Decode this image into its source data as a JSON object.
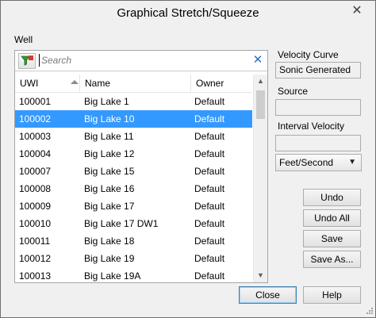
{
  "window": {
    "title": "Graphical Stretch/Squeeze",
    "close_glyph": "✕"
  },
  "well": {
    "label": "Well",
    "search": {
      "placeholder": "Search",
      "value": ""
    },
    "columns": [
      "UWI",
      "Name",
      "Owner"
    ],
    "rows": [
      {
        "uwi": "100001",
        "name": "Big Lake 1",
        "owner": "Default",
        "selected": false
      },
      {
        "uwi": "100002",
        "name": "Big Lake 10",
        "owner": "Default",
        "selected": true
      },
      {
        "uwi": "100003",
        "name": "Big Lake 11",
        "owner": "Default",
        "selected": false
      },
      {
        "uwi": "100004",
        "name": "Big Lake 12",
        "owner": "Default",
        "selected": false
      },
      {
        "uwi": "100007",
        "name": "Big Lake 15",
        "owner": "Default",
        "selected": false
      },
      {
        "uwi": "100008",
        "name": "Big Lake 16",
        "owner": "Default",
        "selected": false
      },
      {
        "uwi": "100009",
        "name": "Big Lake 17",
        "owner": "Default",
        "selected": false
      },
      {
        "uwi": "100010",
        "name": "Big Lake 17 DW1",
        "owner": "Default",
        "selected": false
      },
      {
        "uwi": "100011",
        "name": "Big Lake 18",
        "owner": "Default",
        "selected": false
      },
      {
        "uwi": "100012",
        "name": "Big Lake 19",
        "owner": "Default",
        "selected": false
      },
      {
        "uwi": "100013",
        "name": "Big Lake 19A",
        "owner": "Default",
        "selected": false
      }
    ]
  },
  "velocity_curve": {
    "label": "Velocity Curve",
    "value": "Sonic Generated"
  },
  "source": {
    "label": "Source",
    "value": ""
  },
  "interval_velocity": {
    "label": "Interval Velocity",
    "value": ""
  },
  "units_select": {
    "value": "Feet/Second"
  },
  "buttons": {
    "undo": "Undo",
    "undo_all": "Undo All",
    "save": "Save",
    "save_as": "Save As...",
    "close": "Close",
    "help": "Help"
  },
  "colors": {
    "selection": "#3399ff",
    "clear_icon": "#2a6fc9",
    "filter_icon_green": "#2e9a2e",
    "filter_icon_red": "#d93a2b"
  },
  "icons": {
    "filter": "filter-funnel-icon",
    "clear": "clear-search-icon",
    "sort": "sort-ascending-icon"
  }
}
